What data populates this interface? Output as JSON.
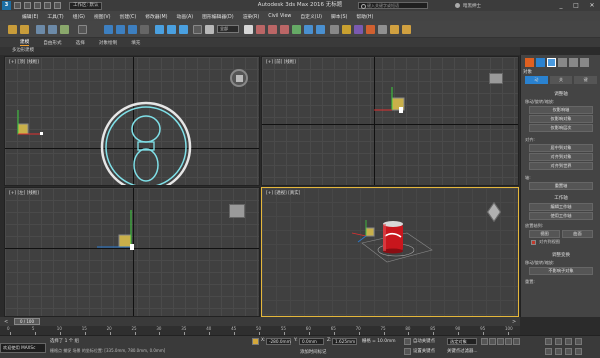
{
  "title_bar": {
    "workspace": "工作区: 默认",
    "window_title": "Autodesk 3ds Max 2016     无标题",
    "search_placeholder": "键入关键字或短语",
    "user": "暗黑绅士",
    "win_controls": [
      "_",
      "□",
      "✕"
    ]
  },
  "menu": [
    "编辑(E)",
    "工具(T)",
    "组(G)",
    "视图(V)",
    "创建(C)",
    "修改器(M)",
    "动画(A)",
    "图形编辑器(D)",
    "渲染(R)",
    "Civil View",
    "自定义(U)",
    "脚本(S)",
    "帮助(H)"
  ],
  "toolbar": {
    "selection_set": "全部"
  },
  "ribbon": {
    "tabs": [
      "建模",
      "自由形式",
      "选择",
      "对象绘制",
      "填充"
    ],
    "active_tab": "建模",
    "sub_label": "多边形建模"
  },
  "viewports": {
    "top": "[+] [顶] [线框]",
    "front": "[+] [前] [线框]",
    "left": "[+] [左] [线框]",
    "perspective": "[+] [透视] [真实]"
  },
  "command_panel": {
    "object_name": "对象",
    "rollout_tabs": [
      "动",
      "关",
      "键"
    ],
    "section_dynamics": "调整轴",
    "move_label": "移动/旋转/缩放:",
    "buttons_pivot": [
      "仅影响轴",
      "仅影响对象",
      "仅影响层次"
    ],
    "align_label": "对齐:",
    "buttons_align": [
      "居中到对象",
      "对齐到对象",
      "对齐到世界"
    ],
    "axis_label": "轴:",
    "reset_axis": "重置轴",
    "working_pivot_head": "工作轴",
    "working_pivot_btns": [
      "编辑工作轴",
      "使用工作轴"
    ],
    "place_pivot_label": "放置轴到:",
    "place_pivot_btns": [
      "视图",
      "曲面"
    ],
    "align_view_check": "对齐到视图",
    "adjust_transform_head": "调整变换",
    "move_rotate_label": "移动/旋转/缩放:",
    "affect_children": "不影响子对象",
    "reset_label": "重置:"
  },
  "timeline": {
    "frame": "0 / 100",
    "ticks": [
      "0",
      "5",
      "10",
      "15",
      "20",
      "25",
      "30",
      "35",
      "40",
      "45",
      "50",
      "55",
      "60",
      "65",
      "70",
      "75",
      "80",
      "85",
      "90",
      "95",
      "100"
    ]
  },
  "status": {
    "maxscript": "欢迎使用 MAXSc",
    "selected": "选择了 1 个 组",
    "hint": "栅格点 捕捉 场景 的坐标位置: [335.0mm, 780.0mm, 0.0mm]",
    "x_label": "X:",
    "x_value": "-280.0mm",
    "y_label": "Y:",
    "y_value": "0.0mm",
    "z_label": "Z:",
    "z_value": "1.625mm",
    "grid_label": "栅格 = 10.0mm",
    "autokey": "自动关键点",
    "selected_dropdown": "选定对象",
    "setkey": "设置关键点",
    "key_filter": "关键点过滤器...",
    "add_time_tag": "添加时间标记"
  }
}
